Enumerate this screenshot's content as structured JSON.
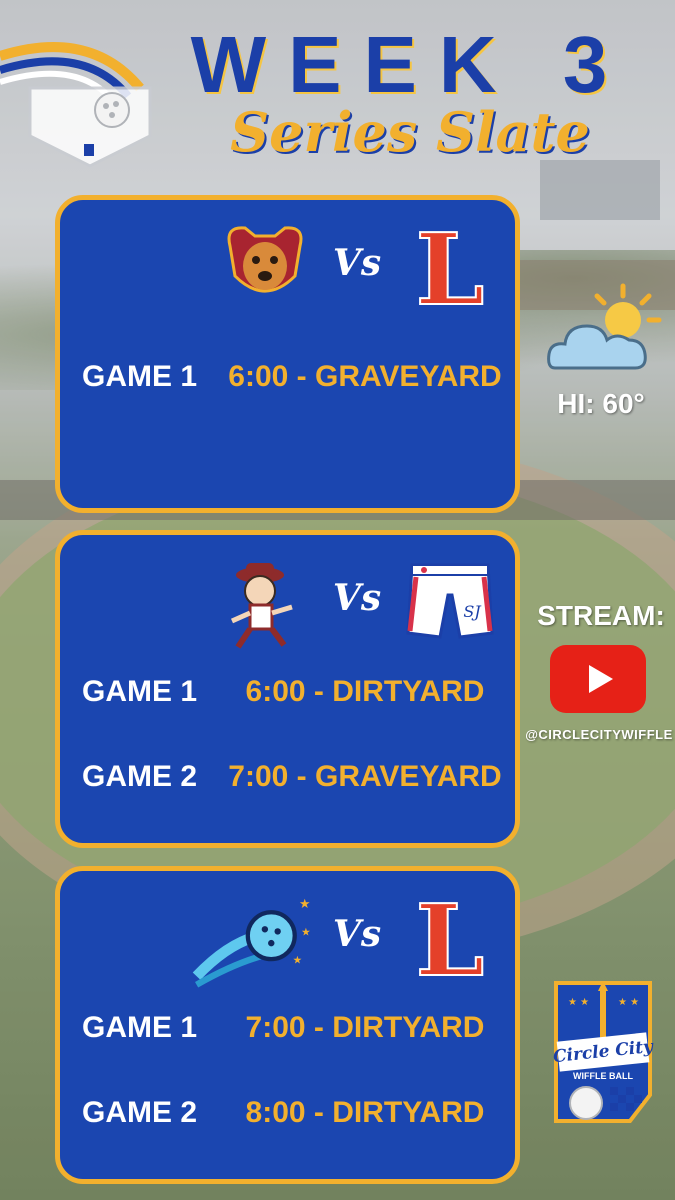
{
  "header": {
    "week": "WEEK 3",
    "subtitle": "Series Slate"
  },
  "matchups": [
    {
      "team_a_icon": "dog-mascot-icon",
      "vs": "Vs",
      "team_b_icon": "letter-l-logo-icon",
      "team_b_letter": "L",
      "games": [
        {
          "label": "GAME 1",
          "time": "6:00 - GRAVEYARD"
        }
      ]
    },
    {
      "team_a_icon": "running-player-mascot-icon",
      "vs": "Vs",
      "team_b_icon": "shorts-logo-icon",
      "games": [
        {
          "label": "GAME 1",
          "time": "6:00 - DIRTYARD"
        },
        {
          "label": "GAME 2",
          "time": "7:00 - GRAVEYARD"
        }
      ]
    },
    {
      "team_a_icon": "comet-ball-logo-icon",
      "vs": "Vs",
      "team_b_icon": "letter-l-logo-icon",
      "team_b_letter": "L",
      "games": [
        {
          "label": "GAME 1",
          "time": "7:00 - DIRTYARD"
        },
        {
          "label": "GAME 2",
          "time": "8:00 - DIRTYARD"
        }
      ]
    }
  ],
  "weather": {
    "icon": "partly-cloudy-icon",
    "high": "HI: 60°"
  },
  "stream": {
    "label": "STREAM:",
    "icon": "youtube-icon",
    "handle": "@CIRCLECITYWIFFLE"
  },
  "league_logo": {
    "icon": "circle-city-wiffle-ball-logo",
    "line1": "Circle City",
    "line2": "WIFFLE BALL"
  },
  "colors": {
    "card_blue": "#1b46b0",
    "gold": "#f2b02e",
    "title_blue": "#1b3fa8",
    "youtube_red": "#e62117"
  }
}
